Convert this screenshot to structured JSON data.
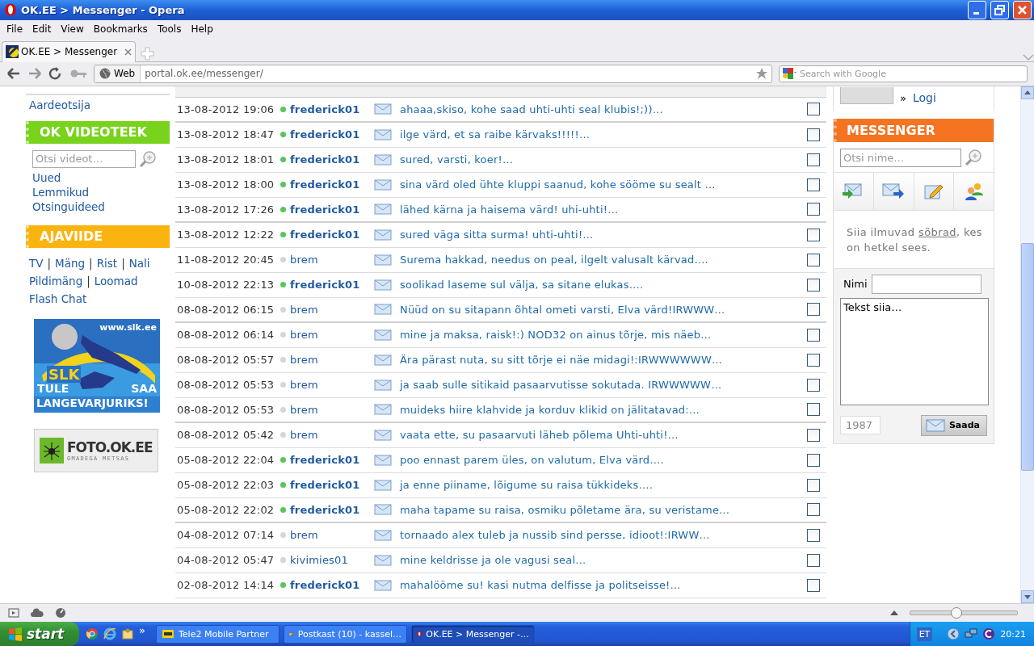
{
  "window": {
    "title": "OK.EE > Messenger - Opera"
  },
  "menu": [
    "File",
    "Edit",
    "View",
    "Bookmarks",
    "Tools",
    "Help"
  ],
  "tabs": [
    {
      "label": "OK.EE > Messenger",
      "selected": true
    }
  ],
  "address": {
    "button": "Web",
    "url": "portal.ok.ee/messenger/"
  },
  "search": {
    "placeholder": "Search with Google"
  },
  "left": {
    "top_link": "Aardeotsija",
    "video": {
      "title": "OK VIDEOTEEK",
      "placeholder": "Otsi videot…",
      "links": [
        "Uued",
        "Lemmikud",
        "Otsinguideed"
      ]
    },
    "fun": {
      "title": "AJAVIIDE",
      "separator": "|",
      "lines": [
        [
          "TV",
          "Mäng",
          "Rist",
          "Nali"
        ],
        [
          "Pildimäng",
          "Loomad"
        ],
        [
          "Flash Chat"
        ]
      ]
    },
    "banner": {
      "url": "www.slk.ee",
      "logo": "SLK",
      "left": "TULE",
      "right": "SAA",
      "bottom": "LANGEVARJURIKS!"
    },
    "foto": {
      "title": "FOTO.OK.EE",
      "subtitle": "OMADEGA METSAS"
    }
  },
  "messages": [
    {
      "date": "13-08-2012 19:06",
      "sender": "frederick01",
      "online": true,
      "text": "ahaaa,skiso, kohe saad uhti-uhti seal klubis!;))…",
      "checked": false
    },
    {
      "date": "13-08-2012 18:47",
      "sender": "frederick01",
      "online": true,
      "text": "ilge värd, et sa raibe kärvaks!!!!!…",
      "checked": false
    },
    {
      "date": "13-08-2012 18:01",
      "sender": "frederick01",
      "online": true,
      "text": "sured, varsti, koer!…",
      "checked": false
    },
    {
      "date": "13-08-2012 18:00",
      "sender": "frederick01",
      "online": true,
      "text": "sina värd oled ühte kluppi saanud, kohe sööme su sealt …",
      "checked": false
    },
    {
      "date": "13-08-2012 17:26",
      "sender": "frederick01",
      "online": true,
      "text": "lähed kärna ja haisema värd! uhi-uhti!…",
      "checked": false
    },
    {
      "date": "13-08-2012 12:22",
      "sender": "frederick01",
      "online": true,
      "text": "sured väga sitta surma! uhti-uhti!…",
      "checked": false
    },
    {
      "date": "11-08-2012 20:45",
      "sender": "brem",
      "online": false,
      "text": "Surema hakkad, needus on peal, ilgelt valusalt kärvad….",
      "checked": false
    },
    {
      "date": "10-08-2012 22:13",
      "sender": "frederick01",
      "online": true,
      "text": "soolikad laseme sul välja, sa sitane elukas….",
      "checked": false
    },
    {
      "date": "08-08-2012 06:15",
      "sender": "brem",
      "online": false,
      "text": "Nüüd on su sitapann õhtal ometi varsti, Elva värd!IRWWW…",
      "checked": false
    },
    {
      "date": "08-08-2012 06:14",
      "sender": "brem",
      "online": false,
      "text": "mine ja maksa, raisk!:) NOD32 on ainus tõrje, mis näeb…",
      "checked": false
    },
    {
      "date": "08-08-2012 05:57",
      "sender": "brem",
      "online": false,
      "text": "Ära pärast nuta, su sitt tõrje ei näe midagi!:IRWWWWWW…",
      "checked": false
    },
    {
      "date": "08-08-2012 05:53",
      "sender": "brem",
      "online": false,
      "text": "ja saab sulle sitikaid pasaarvutisse sokutada. IRWWWWW…",
      "checked": false
    },
    {
      "date": "08-08-2012 05:53",
      "sender": "brem",
      "online": false,
      "text": "muideks hiire klahvide ja korduv klikid on jälitatavad:…",
      "checked": false
    },
    {
      "date": "08-08-2012 05:42",
      "sender": "brem",
      "online": false,
      "text": "vaata ette, su pasaarvuti läheb põlema Uhti-uhti!…",
      "checked": false
    },
    {
      "date": "05-08-2012 22:04",
      "sender": "frederick01",
      "online": true,
      "text": "poo ennast parem üles, on valutum, Elva värd….",
      "checked": false
    },
    {
      "date": "05-08-2012 22:03",
      "sender": "frederick01",
      "online": true,
      "text": "ja enne piiname, lõigume su raisa tükkideks….",
      "checked": false
    },
    {
      "date": "05-08-2012 22:02",
      "sender": "frederick01",
      "online": true,
      "text": "maha tapame su raisa, osmiku põletame ära, su veristame…",
      "checked": false
    },
    {
      "date": "04-08-2012 07:14",
      "sender": "brem",
      "online": false,
      "text": "tornaado alex tuleb ja nussib sind persse, idioot!:IRWW…",
      "checked": false
    },
    {
      "date": "04-08-2012 05:47",
      "sender": "kivimies01",
      "online": false,
      "text": "mine keldrisse ja ole vagusi seal…",
      "checked": false
    },
    {
      "date": "02-08-2012 14:14",
      "sender": "frederick01",
      "online": true,
      "text": "mahalööme su! kasi nutma delfisse ja politseisse!…",
      "checked": false
    }
  ],
  "messenger": {
    "arrow": "»",
    "login": "Logi",
    "title": "MESSENGER",
    "placeholder": "Otsi nime…",
    "info_before": "Siia ilmuvad",
    "info_link": "sõbrad",
    "info_after": ", kes on hetkel sees.",
    "name_label": "Nimi",
    "text_value": "Tekst siia…",
    "counter": "1987",
    "send": "Saada"
  },
  "status_bar": {
    "zoom": {
      "level": 0.43
    }
  },
  "taskbar": {
    "start": "start",
    "more": "»",
    "tasks": [
      {
        "label": "Tele2 Mobile Partner",
        "selected": false
      },
      {
        "label": "Postkast (10) - kassel…",
        "selected": false
      },
      {
        "label": "OK.EE > Messenger -…",
        "selected": true
      }
    ],
    "language": "ET",
    "clock": "20:21"
  }
}
